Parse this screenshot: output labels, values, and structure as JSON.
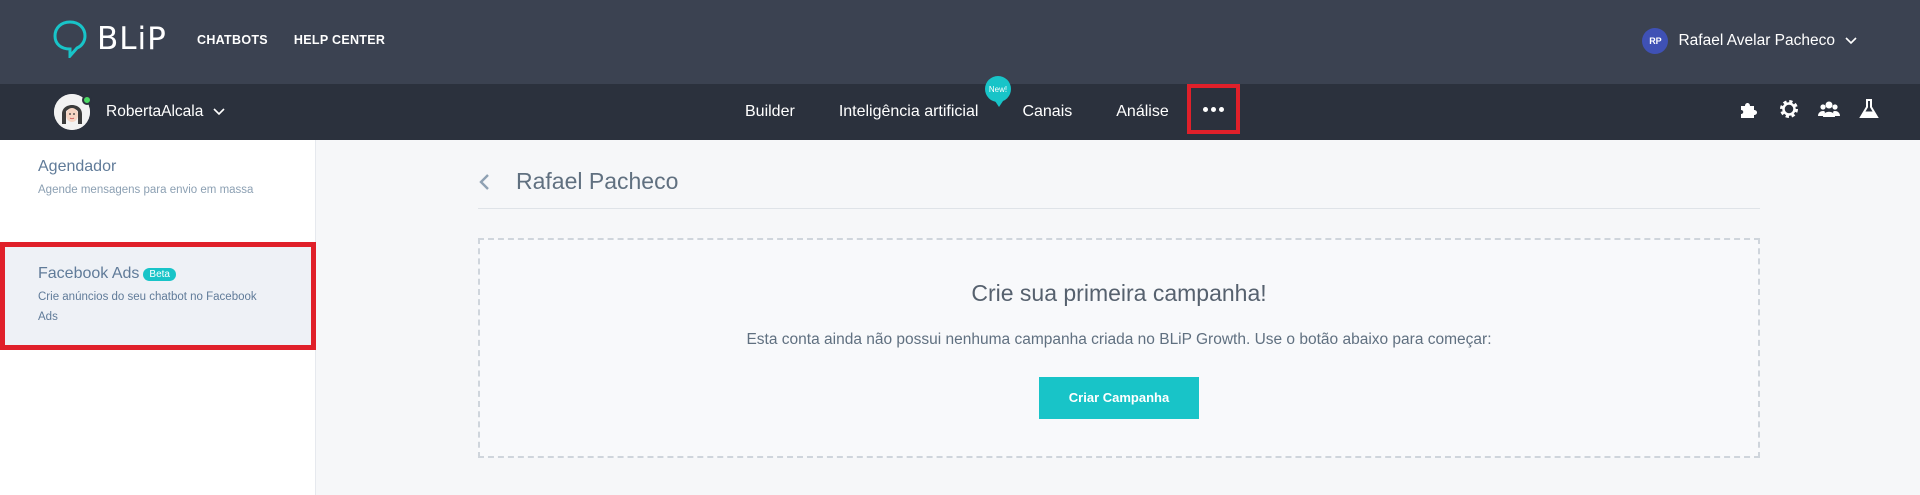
{
  "topbar": {
    "logo": "BLiP",
    "nav": [
      "CHATBOTS",
      "HELP CENTER"
    ],
    "user": {
      "initials": "RP",
      "name": "Rafael Avelar Pacheco"
    }
  },
  "botbar": {
    "bot_name": "RobertaAlcala",
    "nav": [
      "Builder",
      "Inteligência artificial",
      "Canais",
      "Análise"
    ],
    "new_badge": "New!",
    "right_icons": [
      "puzzle-icon",
      "gear-icon",
      "team-icon",
      "flask-icon"
    ]
  },
  "sidebar": {
    "items": [
      {
        "title": "Agendador",
        "description": "Agende mensagens para envio em massa"
      },
      {
        "title": "Facebook Ads",
        "badge": "Beta",
        "description": "Crie anúncios do seu chatbot no Facebook Ads"
      }
    ]
  },
  "main": {
    "title": "Rafael Pacheco",
    "empty_state": {
      "heading": "Crie sua primeira campanha!",
      "text": "Esta conta ainda não possui nenhuma campanha criada no BLiP Growth. Use o botão abaixo para começar:",
      "button": "Criar Campanha"
    }
  },
  "colors": {
    "topbar": "#3b4251",
    "botbar": "#2b313d",
    "accent": "#18c4c8",
    "highlight": "#e0202a"
  }
}
